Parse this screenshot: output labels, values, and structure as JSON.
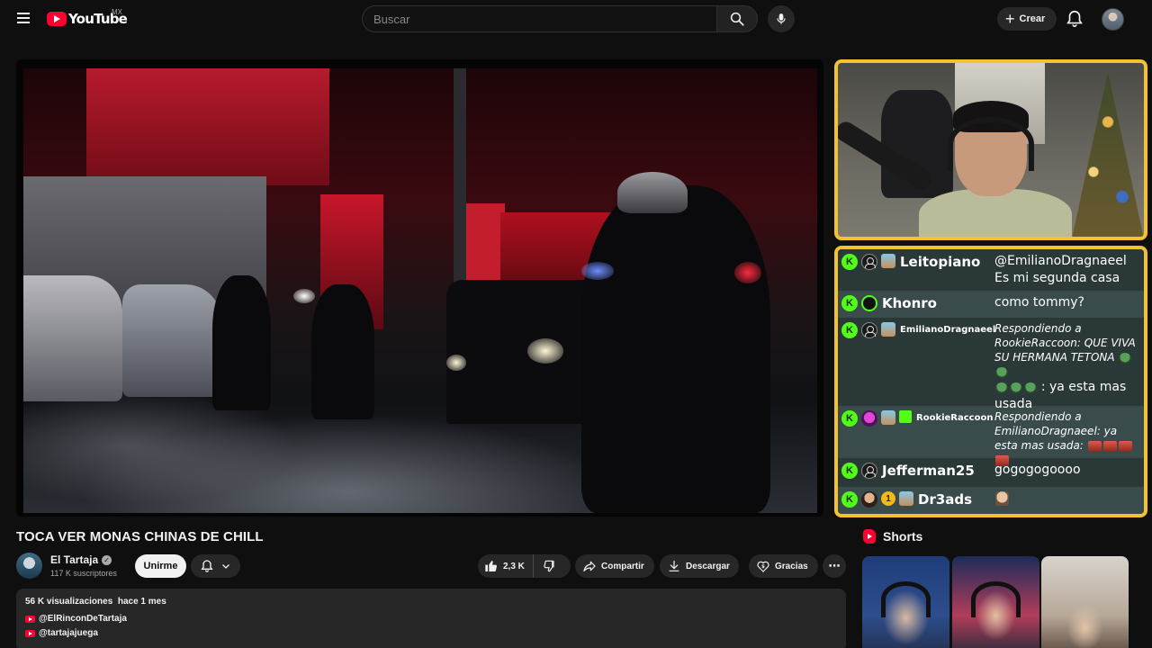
{
  "header": {
    "logo_text": "YouTube",
    "region_code": "MX",
    "search_placeholder": "Buscar",
    "create_label": "Crear"
  },
  "video": {
    "title": "TOCA VER MONAS CHINAS DE CHILL",
    "channel": {
      "name": "El Tartaja",
      "subscribers": "117 K suscriptores",
      "join_label": "Unirme"
    },
    "actions": {
      "likes": "2,3 K",
      "share_label": "Compartir",
      "download_label": "Descargar",
      "thanks_label": "Gracias"
    },
    "description": {
      "views": "56 K visualizaciones",
      "age": "hace 1 mes",
      "links": [
        "@ElRinconDeTartaja",
        "@tartajajuega"
      ]
    }
  },
  "overlay": {
    "border_color": "#f2c230",
    "chat": [
      {
        "user": "Leitopiano",
        "text": "@EmilianoDragnaeel Es mi segunda casa"
      },
      {
        "user": "Khonro",
        "text": "como tommy?"
      },
      {
        "user": "EmilianoDragnaeel",
        "reply": "Respondiendo a RookieRaccoon: QUE VIVA SU HERMANA TETONA",
        "text": ": ya esta mas usada"
      },
      {
        "user": "RookieRaccoon",
        "reply": "Respondiendo a EmilianoDragnaeel: ya esta mas usada:"
      },
      {
        "user": "Jefferman25",
        "text": "gogogogoooo"
      },
      {
        "user": "Dr3ads",
        "badge_number": "1"
      }
    ]
  },
  "shorts": {
    "title": "Shorts"
  },
  "colors": {
    "background": "#0f0f0f",
    "brand_red": "#ff0033",
    "kick_green": "#53fc18"
  }
}
